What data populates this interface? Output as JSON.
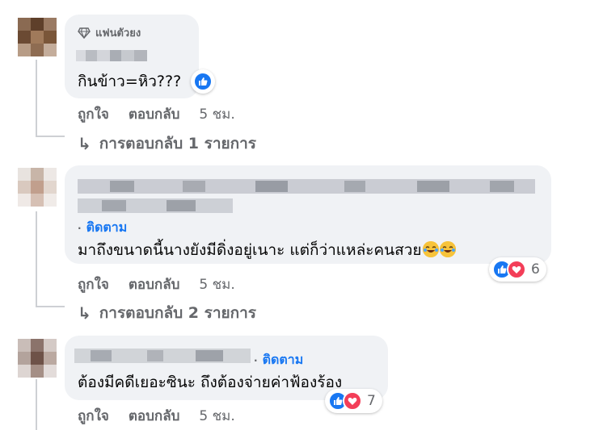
{
  "comments": [
    {
      "badge": "แฟนตัวยง",
      "text": "กินข้าว=หิว???",
      "actions": {
        "like": "ถูกใจ",
        "reply": "ตอบกลับ",
        "time": "5 ชม."
      },
      "replies_link": "การตอบกลับ 1 รายการ",
      "reaction": {
        "types": [
          "like"
        ]
      }
    },
    {
      "follow": "ติดตาม",
      "text": "มาถึงขนาดนี้นางยังมีดิ่งอยู่เนาะ แต่ก็ว่าแหล่ะคนสวย",
      "actions": {
        "like": "ถูกใจ",
        "reply": "ตอบกลับ",
        "time": "5 ชม."
      },
      "replies_link": "การตอบกลับ 2 รายการ",
      "reaction": {
        "types": [
          "like",
          "love"
        ],
        "count": "6"
      }
    },
    {
      "follow": "ติดตาม",
      "text": "ต้องมีคดีเยอะซินะ ถึงต้องจ่ายค่าฟ้องร้อง",
      "actions": {
        "like": "ถูกใจ",
        "reply": "ตอบกลับ",
        "time": "5 ชม."
      },
      "reaction": {
        "types": [
          "like",
          "love"
        ],
        "count": "7"
      }
    }
  ],
  "colors": {
    "bubble": "#f0f2f5",
    "link_blue": "#1877f2",
    "secondary_text": "#65676b",
    "love_red": "#f33e58"
  }
}
